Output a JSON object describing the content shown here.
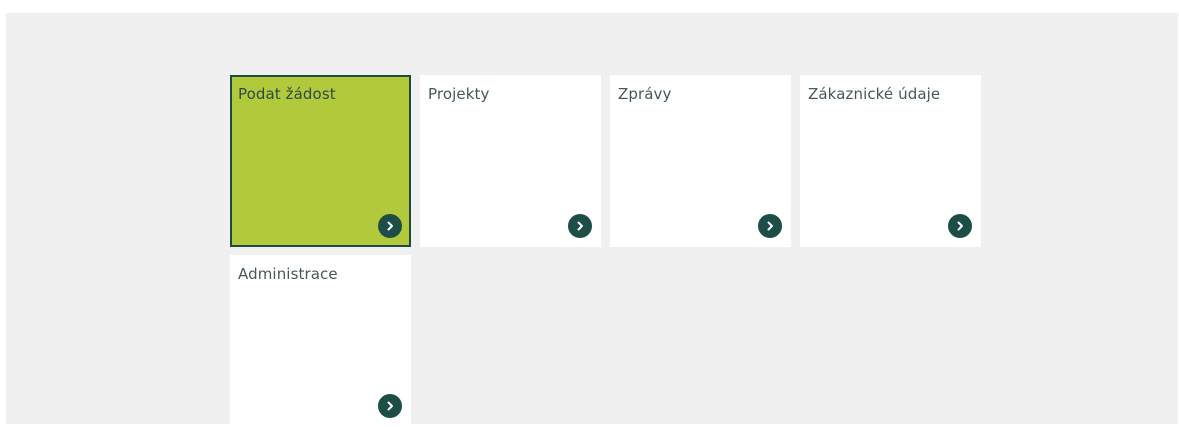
{
  "tiles": [
    {
      "label": "Podat žádost",
      "active": true,
      "icon": "chevron-right-icon"
    },
    {
      "label": "Projekty",
      "active": false,
      "icon": "chevron-right-icon"
    },
    {
      "label": "Zprávy",
      "active": false,
      "icon": "chevron-right-icon"
    },
    {
      "label": "Zákaznické údaje",
      "active": false,
      "icon": "chevron-right-icon"
    },
    {
      "label": "Administrace",
      "active": false,
      "icon": "chevron-right-icon"
    }
  ],
  "colors": {
    "background": "#f0f0f0",
    "tile": "#ffffff",
    "active_tile": "#b1c93a",
    "accent": "#1d4d47",
    "text": "#455a58"
  }
}
